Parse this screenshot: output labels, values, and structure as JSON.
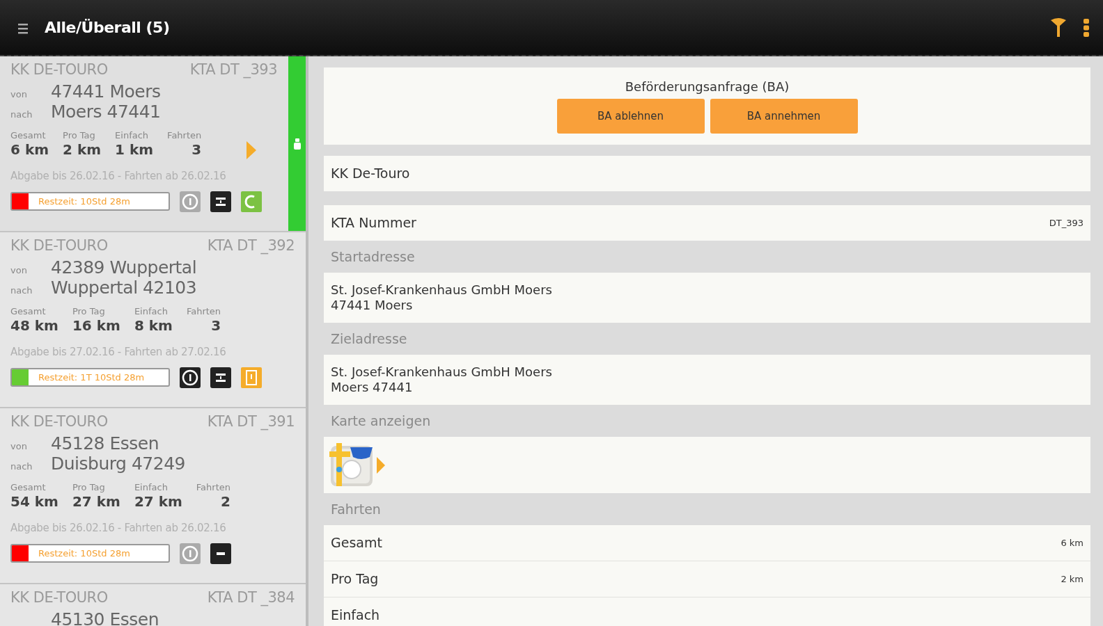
{
  "header": {
    "title": "Alle/Überall (5)"
  },
  "requests": [
    {
      "selected": true,
      "insurer": "KK DE-TOURO",
      "kta": "KTA DT _393",
      "from_label": "von",
      "from": "47441 Moers",
      "to_label": "nach",
      "to": "Moers 47441",
      "stats": [
        {
          "label": "Gesamt",
          "value": "6 km"
        },
        {
          "label": "Pro Tag",
          "value": "2 km"
        },
        {
          "label": "Einfach",
          "value": "1 km"
        },
        {
          "label": "Fahrten",
          "value": "3"
        }
      ],
      "dates": "Abgabe bis 26.02.16 - Fahrten ab 26.02.16",
      "remaining": {
        "text": "Restzeit: 10Std 28m",
        "color": "#ff0000"
      },
      "icons": [
        {
          "kind": "info",
          "active": false
        },
        {
          "kind": "transfer",
          "active": true
        },
        {
          "kind": "money",
          "active": true
        }
      ]
    },
    {
      "selected": false,
      "insurer": "KK DE-TOURO",
      "kta": "KTA DT _392",
      "from_label": "von",
      "from": "42389 Wuppertal",
      "to_label": "nach",
      "to": "Wuppertal 42103",
      "stats": [
        {
          "label": "Gesamt",
          "value": "48 km"
        },
        {
          "label": "Pro Tag",
          "value": "16 km"
        },
        {
          "label": "Einfach",
          "value": "8 km"
        },
        {
          "label": "Fahrten",
          "value": "3"
        }
      ],
      "dates": "Abgabe bis 27.02.16 - Fahrten ab 27.02.16",
      "remaining": {
        "text": "Restzeit: 1T 10Std 28m",
        "color": "#66cc33"
      },
      "icons": [
        {
          "kind": "info",
          "active": true
        },
        {
          "kind": "transfer",
          "active": true
        },
        {
          "kind": "document",
          "active": true
        }
      ]
    },
    {
      "selected": false,
      "insurer": "KK DE-TOURO",
      "kta": "KTA DT _391",
      "from_label": "von",
      "from": "45128 Essen",
      "to_label": "nach",
      "to": "Duisburg 47249",
      "stats": [
        {
          "label": "Gesamt",
          "value": "54 km"
        },
        {
          "label": "Pro Tag",
          "value": "27 km"
        },
        {
          "label": "Einfach",
          "value": "27 km"
        },
        {
          "label": "Fahrten",
          "value": "2"
        }
      ],
      "dates": "Abgabe bis 26.02.16 - Fahrten ab 26.02.16",
      "remaining": {
        "text": "Restzeit: 10Std 28m",
        "color": "#ff0000"
      },
      "icons": [
        {
          "kind": "info",
          "active": false
        },
        {
          "kind": "minus",
          "active": true
        }
      ]
    },
    {
      "selected": false,
      "insurer": "KK DE-TOURO",
      "kta": "KTA DT _384",
      "from": "45130 Essen"
    }
  ],
  "detail": {
    "request": {
      "title": "Beförderungsanfrage (BA)",
      "buttons": [
        "BA ablehnen",
        "BA annehmen"
      ]
    },
    "sections": [
      {
        "kind": "text",
        "text": "KK De-Touro"
      },
      {
        "kind": "field",
        "label": "KTA Nummer",
        "value": "DT_393"
      },
      {
        "kind": "heading",
        "text": "Startadresse"
      },
      {
        "kind": "address",
        "lines": [
          "St. Josef-Krankenhaus GmbH Moers",
          "47441 Moers"
        ]
      },
      {
        "kind": "heading",
        "text": "Zieladresse"
      },
      {
        "kind": "address",
        "lines": [
          "St. Josef-Krankenhaus GmbH Moers",
          "Moers 47441"
        ]
      },
      {
        "kind": "heading",
        "text": "Karte anzeigen"
      },
      {
        "kind": "map"
      },
      {
        "kind": "heading",
        "text": "Fahrten"
      },
      {
        "kind": "rows",
        "rows": [
          {
            "label": "Gesamt",
            "value": "6 km"
          },
          {
            "label": "Pro Tag",
            "value": "2 km"
          },
          {
            "label": "Einfach"
          }
        ]
      }
    ]
  }
}
